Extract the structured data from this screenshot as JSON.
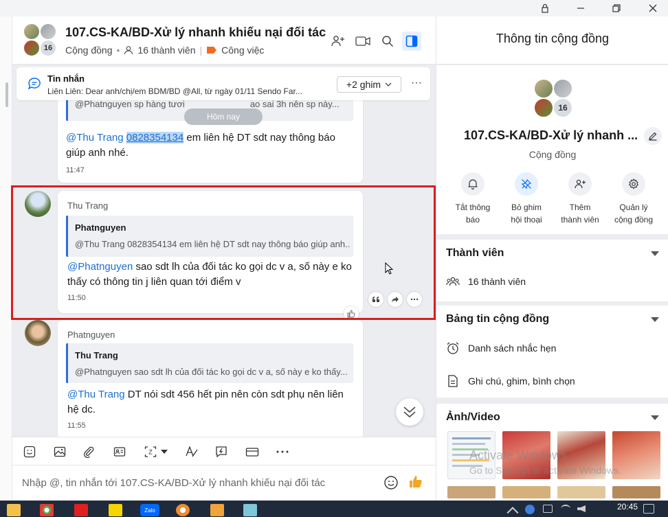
{
  "window": {
    "controls": [
      "lock-icon",
      "minimize-icon",
      "restore-icon",
      "close-icon"
    ]
  },
  "header": {
    "title": "107.CS-KA/BD-Xử lý nhanh khiếu nại đối tác",
    "community_label": "Cộng đồng",
    "members_label": "16 thành viên",
    "tag_label": "Công việc",
    "avatar_count": "16",
    "tag_color": "#f26b21"
  },
  "pinned": {
    "title": "Tin nhắn",
    "preview": "Liên Liên: Dear anh/chị/em BDM/BD @All, từ ngày 01/11 Sendo Far...",
    "pin_count_label": "+2 ghim",
    "more_label": "···"
  },
  "today_label": "Hôm nay",
  "messages": [
    {
      "sender": "Thu Trang",
      "quote_text": "@Phatnguyen sp hàng tươi",
      "quote_tail": "ao sai 3h nên sp này...",
      "mention": "@Thu Trang",
      "phone": "0828354134",
      "text_after": " em liên hệ DT sdt nay thông báo",
      "text_line2": "giúp anh nhé.",
      "time": "11:47"
    },
    {
      "sender": "Thu Trang",
      "quote_author": "Phatnguyen",
      "quote_text": "@Thu Trang 0828354134 em liên hệ DT sdt nay thông báo giúp anh...",
      "mention": "@Phatnguyen",
      "text_after": " sao sdt lh của đối tác ko gọi dc v a, số này e ko",
      "text_line2": "thấy có thông tin j liên quan tới điểm v",
      "time": "11:50"
    },
    {
      "sender": "Phatnguyen",
      "quote_author": "Thu Trang",
      "quote_text": "@Phatnguyen sao sdt lh của đối tác ko gọi dc v a, số này e ko thấy...",
      "mention": "@Thu Trang",
      "text_after": " DT nói sdt 456 hết pin nên còn sdt phụ nên liên",
      "text_line2": "hệ dc.",
      "time": "11:55"
    }
  ],
  "composer": {
    "placeholder": "Nhập @, tin nhắn tới 107.CS-KA/BD-Xử lý nhanh khiếu nại đối tác"
  },
  "panel": {
    "title": "Thông tin cộng đồng",
    "group_name": "107.CS-KA/BD-Xử lý nhanh ...",
    "group_type": "Cộng đồng",
    "avatar_count": "16",
    "actions": [
      {
        "line1": "Tắt thông",
        "line2": "báo",
        "icon": "bell-icon"
      },
      {
        "line1": "Bỏ ghim",
        "line2": "hội thoại",
        "icon": "unpin-icon"
      },
      {
        "line1": "Thêm",
        "line2": "thành viên",
        "icon": "add-member-icon"
      },
      {
        "line1": "Quản lý",
        "line2": "cộng đồng",
        "icon": "gear-icon"
      }
    ],
    "members_section": {
      "title": "Thành viên",
      "row": "16 thành viên"
    },
    "board_section": {
      "title": "Bảng tin cộng đồng",
      "row1": "Danh sách nhắc hẹn",
      "row2": "Ghi chú, ghim, bình chọn"
    },
    "media_section": {
      "title": "Ảnh/Video"
    },
    "watermark_line1": "Activate Windows",
    "watermark_line2": "Go to Settings to activate Windows."
  },
  "taskbar": {
    "time": "20:45"
  },
  "colors": {
    "accent": "#0068ff",
    "highlight": "#d81e1e",
    "mention": "#1a6fd1"
  }
}
